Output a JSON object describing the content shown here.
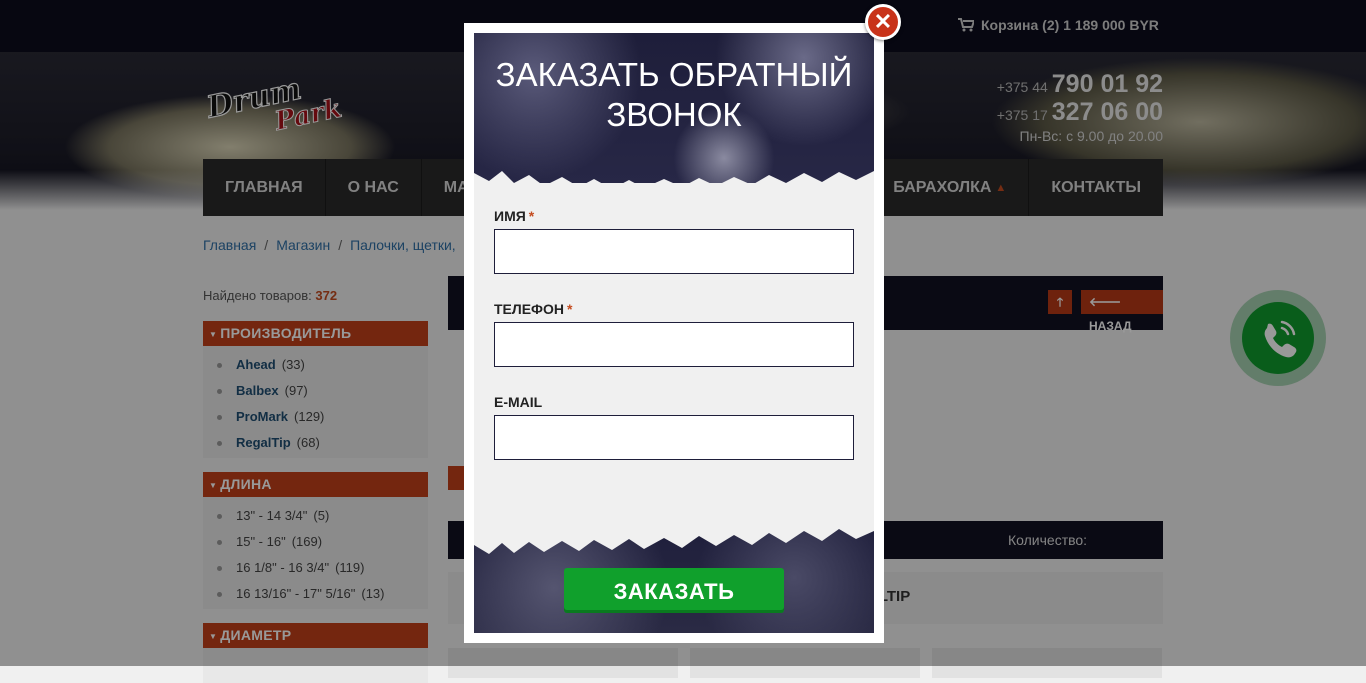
{
  "header": {
    "cart_label": "Корзина (2) 1 189 000 BYR",
    "phones": [
      {
        "prefix": "+375 44",
        "number": "790 01 92"
      },
      {
        "prefix": "+375 17",
        "number": "327 06 00"
      }
    ],
    "hours": "Пн-Вс: с 9.00 до 20.00",
    "logo_text": "Drum Park"
  },
  "nav": {
    "items": [
      "ГЛАВНАЯ",
      "О НАС",
      "МА",
      "БАРАХОЛКА",
      "КОНТАКТЫ"
    ]
  },
  "breadcrumbs": [
    "Главная",
    "Магазин",
    "Палочки, щетки,"
  ],
  "sidebar": {
    "found_label": "Найдено товаров:",
    "found_count": "372",
    "filters": [
      {
        "title": "ПРОИЗВОДИТЕЛЬ",
        "items": [
          {
            "name": "Ahead",
            "count": "(33)"
          },
          {
            "name": "Balbex",
            "count": "(97)"
          },
          {
            "name": "ProMark",
            "count": "(129)"
          },
          {
            "name": "RegalTip",
            "count": "(68)"
          }
        ]
      },
      {
        "title": "ДЛИНА",
        "items": [
          {
            "name": "13\" - 14 3/4\"",
            "count": "(5)"
          },
          {
            "name": "15\" - 16\"",
            "count": "(169)"
          },
          {
            "name": "16 1/8\" - 16 3/4\"",
            "count": "(119)"
          },
          {
            "name": "16 13/16\" - 17\" 5/16\"",
            "count": "(13)"
          }
        ]
      },
      {
        "title": "ДИАМЕТР",
        "items": []
      }
    ]
  },
  "content": {
    "back_label": "НАЗАД",
    "qty_label": "Количество:",
    "product_name_fragment": "ALTIP"
  },
  "modal": {
    "title": "ЗАКАЗАТЬ ОБРАТНЫЙ ЗВОНОК",
    "fields": [
      {
        "label": "ИМЯ",
        "required": "*"
      },
      {
        "label": "ТЕЛЕФОН",
        "required": "*"
      },
      {
        "label": "E-MAIL",
        "required": ""
      }
    ],
    "submit_label": "ЗАКАЗАТЬ",
    "close_glyph": "✕"
  },
  "colors": {
    "accent": "#c2401a",
    "dark": "#111122",
    "submit_green": "#10a02c"
  }
}
